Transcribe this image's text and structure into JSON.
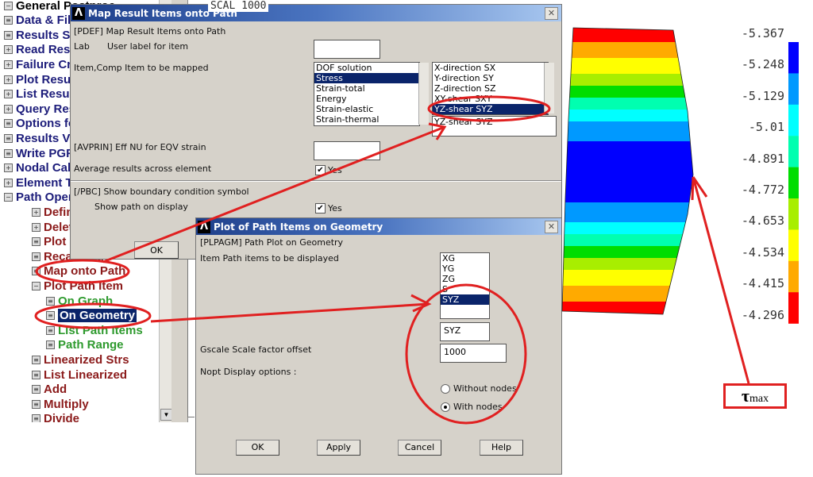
{
  "top_text": "SCAL 1000",
  "tree": {
    "items": [
      {
        "label": "General Postproc",
        "level": 0,
        "icon": "minus"
      },
      {
        "label": "Data & File Opts",
        "level": 0,
        "icon": "form"
      },
      {
        "label": "Results Summary",
        "level": 0,
        "icon": "form"
      },
      {
        "label": "Read Results",
        "level": 0,
        "icon": "plus"
      },
      {
        "label": "Failure Criteria",
        "level": 0,
        "icon": "plus"
      },
      {
        "label": "Plot Results",
        "level": 0,
        "icon": "plus"
      },
      {
        "label": "List Results",
        "level": 0,
        "icon": "plus"
      },
      {
        "label": "Query Results",
        "level": 0,
        "icon": "plus"
      },
      {
        "label": "Options for Outp",
        "level": 0,
        "icon": "form"
      },
      {
        "label": "Results Viewer",
        "level": 0,
        "icon": "form"
      },
      {
        "label": "Write PGR File",
        "level": 0,
        "icon": "form"
      },
      {
        "label": "Nodal Calcs",
        "level": 0,
        "icon": "plus"
      },
      {
        "label": "Element Table",
        "level": 0,
        "icon": "plus"
      },
      {
        "label": "Path Operations",
        "level": 0,
        "icon": "minus"
      },
      {
        "label": "Define Path",
        "level": 1,
        "icon": "plus"
      },
      {
        "label": "Delete Path",
        "level": 1,
        "icon": "plus"
      },
      {
        "label": "Plot Paths",
        "level": 1,
        "icon": "form"
      },
      {
        "label": "Recall Path",
        "level": 1,
        "icon": "form"
      },
      {
        "label": "Map onto Path",
        "level": 1,
        "icon": "form"
      },
      {
        "label": "Plot Path Item",
        "level": 1,
        "icon": "minus"
      },
      {
        "label": "On Graph",
        "level": 2,
        "icon": "form"
      },
      {
        "label": "On Geometry",
        "level": 2,
        "icon": "form",
        "selected": true
      },
      {
        "label": "List Path Items",
        "level": 2,
        "icon": "form"
      },
      {
        "label": "Path Range",
        "level": 2,
        "icon": "form"
      },
      {
        "label": "Linearized Strs",
        "level": 1,
        "icon": "form"
      },
      {
        "label": "List Linearized",
        "level": 1,
        "icon": "form"
      },
      {
        "label": "Add",
        "level": 1,
        "icon": "form"
      },
      {
        "label": "Multiply",
        "level": 1,
        "icon": "form"
      },
      {
        "label": "Divide",
        "level": 1,
        "icon": "form"
      }
    ]
  },
  "map_dialog": {
    "title": "Map Result Items onto Path",
    "cmd": "[PDEF]  Map Result Items onto Path",
    "lab_key": "Lab",
    "lab_desc": "User label for item",
    "lab_value": "",
    "item_key": "Item,Comp  Item to be mapped",
    "item_list": [
      "DOF solution",
      "Stress",
      "Strain-total",
      "Energy",
      "Strain-elastic",
      "Strain-thermal"
    ],
    "item_selected": "Stress",
    "comp_list": [
      "X-direction   SX",
      "Y-direction   SY",
      "Z-direction   SZ",
      "XY-shear   SXY",
      "YZ-shear     SYZ"
    ],
    "comp_selected": "YZ-shear     SYZ",
    "comp_value": "YZ-shear     SYZ",
    "avprin": "[AVPRIN]  Eff NU for EQV strain",
    "avprin_value": "",
    "avg": "Average results across element",
    "avg_check": "Yes",
    "pbc": "[/PBC]  Show boundary condition symbol",
    "showpath": "Show path on display",
    "showpath_check": "Yes",
    "ok": "OK"
  },
  "plot_dialog": {
    "title": "Plot of Path Items on Geometry",
    "cmd": "[PLPAGM]  Path Plot on Geometry",
    "item": "Item   Path items to be displayed",
    "list": [
      "XG",
      "YG",
      "ZG",
      "S",
      "SYZ"
    ],
    "selected": "SYZ",
    "item_value": "SYZ",
    "gscale": "Gscale    Scale factor offset",
    "gscale_value": "1000",
    "nopt": "Nopt       Display options :",
    "options": [
      "Without nodes",
      "With nodes"
    ],
    "option_selected": "With nodes",
    "buttons": [
      "OK",
      "Apply",
      "Cancel",
      "Help"
    ]
  },
  "contour": {
    "legend_labels": [
      "-5.367",
      "-5.248",
      "-5.129",
      "-5.01",
      "-4.891",
      "-4.772",
      "-4.653",
      "-4.534",
      "-4.415",
      "-4.296"
    ],
    "legend_colors": [
      "#0000ff",
      "#0099ff",
      "#00ffff",
      "#00ffb0",
      "#00dd00",
      "#a8ee00",
      "#ffff00",
      "#ffaa00",
      "#ff0000"
    ],
    "annotation": "τ",
    "annotation_sub": "max",
    "annotation_color": "#e02020"
  }
}
